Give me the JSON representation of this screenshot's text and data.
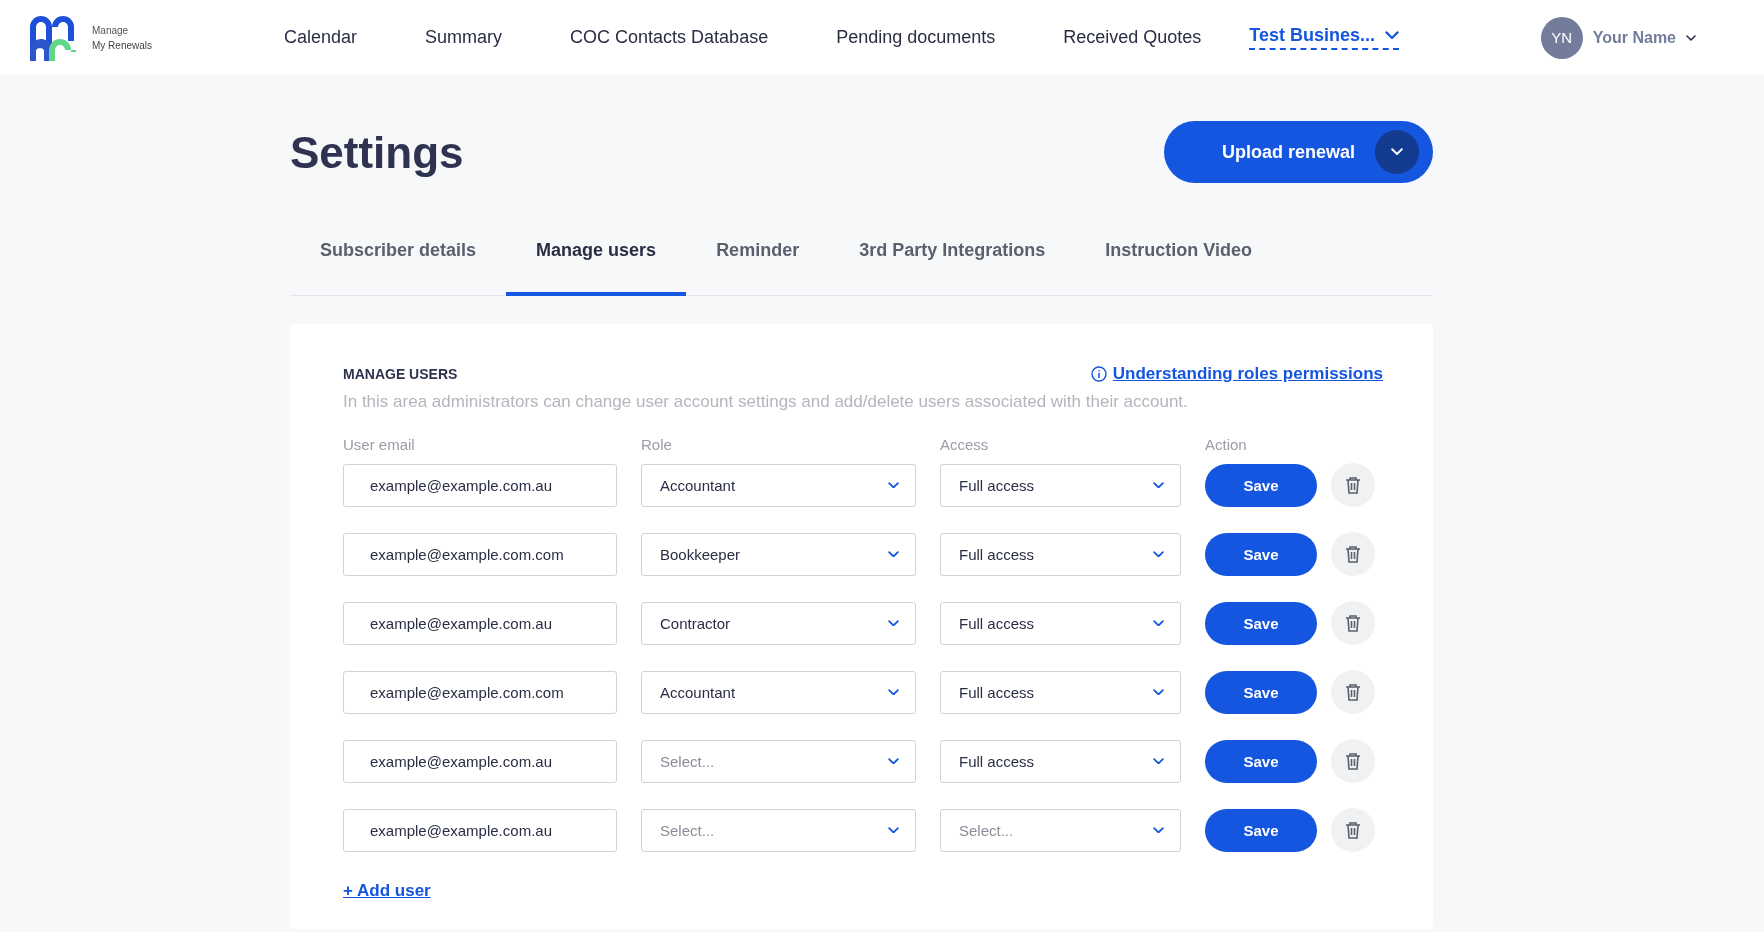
{
  "brand": {
    "line1": "Manage",
    "line2": "My Renewals"
  },
  "nav": [
    {
      "label": "Calendar"
    },
    {
      "label": "Summary"
    },
    {
      "label": "COC Contacts Database"
    },
    {
      "label": "Pending documents"
    },
    {
      "label": "Received Quotes"
    }
  ],
  "business_selector": {
    "label": "Test Busines..."
  },
  "user": {
    "initials": "YN",
    "name": "Your Name"
  },
  "page_title": "Settings",
  "upload_button": {
    "label": "Upload renewal"
  },
  "tabs": [
    {
      "label": "Subscriber details",
      "selected": false
    },
    {
      "label": "Manage users",
      "selected": true
    },
    {
      "label": "Reminder",
      "selected": false
    },
    {
      "label": "3rd Party Integrations",
      "selected": false
    },
    {
      "label": "Instruction Video",
      "selected": false
    }
  ],
  "section": {
    "title": "MANAGE USERS",
    "help_link": "Understanding roles permissions",
    "description": "In this area administrators can change user account settings and add/delete users associated with their account."
  },
  "columns": [
    "User email",
    "Role",
    "Access",
    "Action"
  ],
  "users": [
    {
      "email": "example@example.com.au",
      "role": {
        "value": "Accountant"
      },
      "access": {
        "value": "Full access"
      },
      "save": "Save"
    },
    {
      "email": "example@example.com.com",
      "role": {
        "value": "Bookkeeper"
      },
      "access": {
        "value": "Full access"
      },
      "save": "Save"
    },
    {
      "email": "example@example.com.au",
      "role": {
        "value": "Contractor"
      },
      "access": {
        "value": "Full access"
      },
      "save": "Save"
    },
    {
      "email": "example@example.com.com",
      "role": {
        "value": "Accountant"
      },
      "access": {
        "value": "Full access"
      },
      "save": "Save"
    },
    {
      "email": "example@example.com.au",
      "role": {
        "placeholder": "Select..."
      },
      "access": {
        "value": "Full access"
      },
      "save": "Save"
    },
    {
      "email": "example@example.com.au",
      "role": {
        "placeholder": "Select..."
      },
      "access": {
        "placeholder": "Select..."
      },
      "save": "Save"
    }
  ],
  "add_user": "+ Add user"
}
